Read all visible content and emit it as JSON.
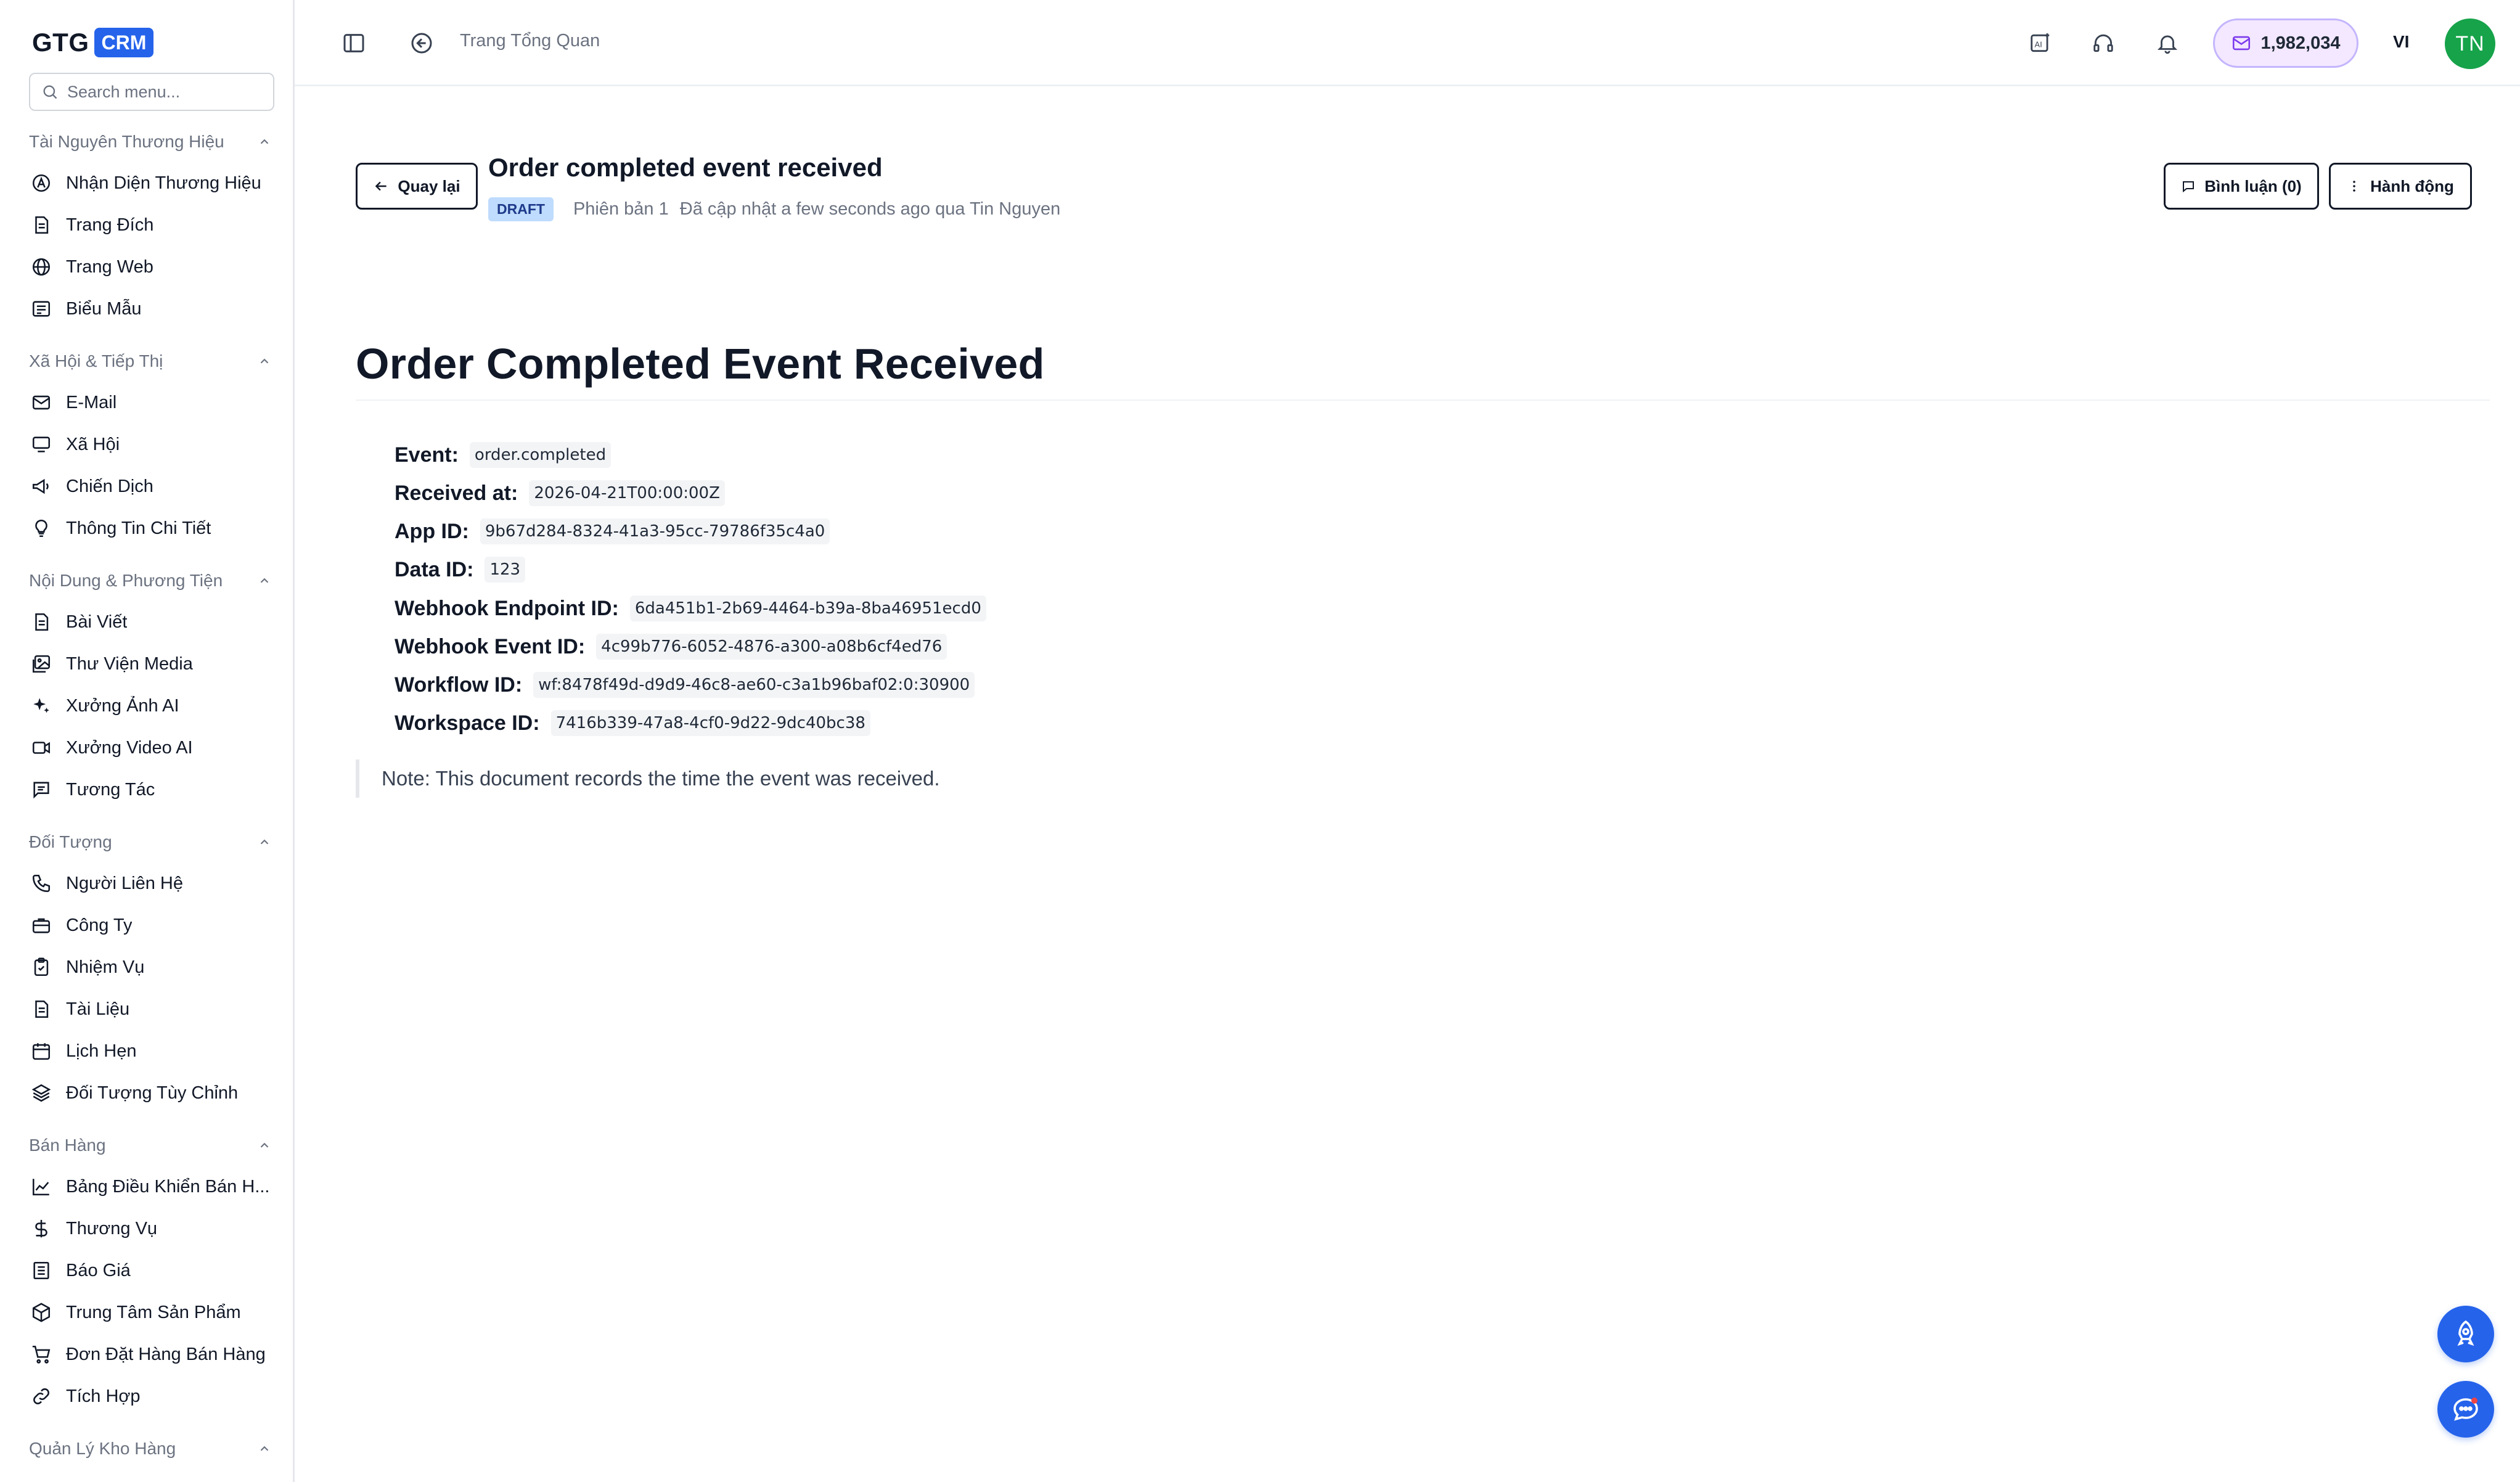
{
  "app": {
    "brand": "GTG",
    "badge": "CRM"
  },
  "sidebar": {
    "search_placeholder": "Search menu...",
    "sections": [
      {
        "title": "Tài Nguyên Thương Hiệu",
        "items": [
          {
            "label": "Nhận Diện Thương Hiệu",
            "icon": "brand-identity-icon"
          },
          {
            "label": "Trang Đích",
            "icon": "landing-page-icon"
          },
          {
            "label": "Trang Web",
            "icon": "globe-icon"
          },
          {
            "label": "Biểu Mẫu",
            "icon": "form-icon"
          }
        ]
      },
      {
        "title": "Xã Hội & Tiếp Thị",
        "items": [
          {
            "label": "E-Mail",
            "icon": "mail-icon"
          },
          {
            "label": "Xã Hội",
            "icon": "monitor-icon"
          },
          {
            "label": "Chiến Dịch",
            "icon": "megaphone-icon"
          },
          {
            "label": "Thông Tin Chi Tiết",
            "icon": "lightbulb-icon"
          }
        ]
      },
      {
        "title": "Nội Dung & Phương Tiện",
        "items": [
          {
            "label": "Bài Viết",
            "icon": "article-icon"
          },
          {
            "label": "Thư Viện Media",
            "icon": "image-library-icon"
          },
          {
            "label": "Xưởng Ảnh AI",
            "icon": "sparkles-icon"
          },
          {
            "label": "Xưởng Video AI",
            "icon": "video-icon"
          },
          {
            "label": "Tương Tác",
            "icon": "chat-icon"
          }
        ]
      },
      {
        "title": "Đối Tượng",
        "items": [
          {
            "label": "Người Liên Hệ",
            "icon": "phone-icon"
          },
          {
            "label": "Công Ty",
            "icon": "briefcase-icon"
          },
          {
            "label": "Nhiệm Vụ",
            "icon": "clipboard-check-icon"
          },
          {
            "label": "Tài Liệu",
            "icon": "document-icon"
          },
          {
            "label": "Lịch Hẹn",
            "icon": "calendar-icon"
          },
          {
            "label": "Đối Tượng Tùy Chỉnh",
            "icon": "layers-icon"
          }
        ]
      },
      {
        "title": "Bán Hàng",
        "items": [
          {
            "label": "Bảng Điều Khiển Bán H...",
            "icon": "line-chart-icon"
          },
          {
            "label": "Thương Vụ",
            "icon": "dollar-icon"
          },
          {
            "label": "Báo Giá",
            "icon": "receipt-icon"
          },
          {
            "label": "Trung Tâm Sản Phẩm",
            "icon": "box-icon"
          },
          {
            "label": "Đơn Đặt Hàng Bán Hàng",
            "icon": "cart-icon"
          },
          {
            "label": "Tích Hợp",
            "icon": "link-icon"
          }
        ]
      },
      {
        "title": "Quản Lý Kho Hàng",
        "items": []
      }
    ]
  },
  "topbar": {
    "breadcrumb": "Trang Tổng Quan",
    "credits": "1,982,034",
    "language": "VI",
    "avatar_initials": "TN"
  },
  "document": {
    "back_label": "Quay lại",
    "title": "Order completed event received",
    "status": "DRAFT",
    "version": "Phiên bản 1",
    "updated": "Đã cập nhật a few seconds ago qua Tin Nguyen",
    "comments_label": "Bình luận (0)",
    "actions_label": "Hành động",
    "heading": "Order Completed Event Received",
    "fields": [
      {
        "key": "Event:",
        "value": "order.completed"
      },
      {
        "key": "Received at:",
        "value": "2026-04-21T00:00:00Z"
      },
      {
        "key": "App ID:",
        "value": "9b67d284-8324-41a3-95cc-79786f35c4a0"
      },
      {
        "key": "Data ID:",
        "value": "123"
      },
      {
        "key": "Webhook Endpoint ID:",
        "value": "6da451b1-2b69-4464-b39a-8ba46951ecd0"
      },
      {
        "key": "Webhook Event ID:",
        "value": "4c99b776-6052-4876-a300-a08b6cf4ed76"
      },
      {
        "key": "Workflow ID:",
        "value": "wf:8478f49d-d9d9-46c8-ae60-c3a1b96baf02:0:30900"
      },
      {
        "key": "Workspace ID:",
        "value": "7416b339-47a8-4cf0-9d22-9dc40bc38"
      }
    ],
    "note": "Note: This document records the time the event was received."
  },
  "colors": {
    "accent": "#2563eb",
    "avatar": "#16a34a",
    "draft_bg": "#bfdbfe",
    "credits_bg": "#f3e8ff"
  }
}
